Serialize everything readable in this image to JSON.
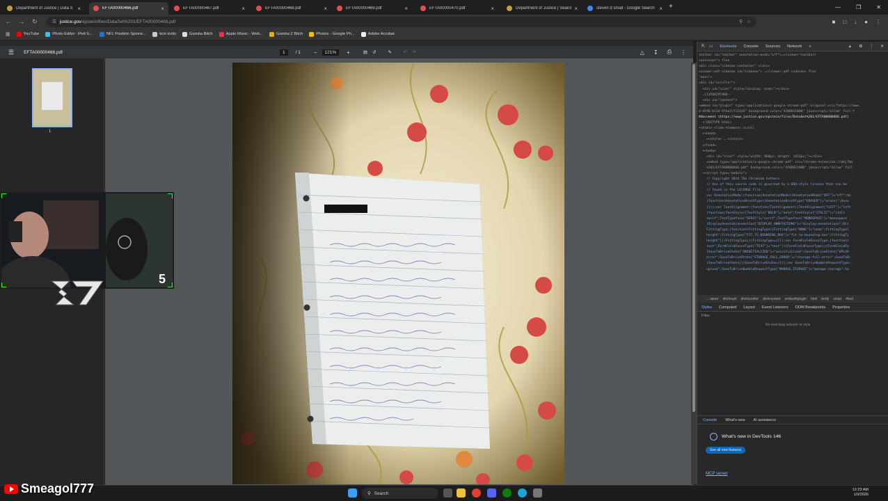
{
  "tabs": [
    {
      "title": "Department of Justice | Data S",
      "color": "#c0a040"
    },
    {
      "title": "EFTA00000466.pdf",
      "color": "#e05050",
      "active": true
    },
    {
      "title": "EFTA00000467.pdf",
      "color": "#e05050"
    },
    {
      "title": "EFTA00000468.pdf",
      "color": "#e05050"
    },
    {
      "title": "EFTA00000469.pdf",
      "color": "#e05050"
    },
    {
      "title": "EFTA00000470.pdf",
      "color": "#e05050"
    },
    {
      "title": "Department of Justice | Search",
      "color": "#c0a040"
    },
    {
      "title": "steven d small - Google Search",
      "color": "#4285f4"
    }
  ],
  "address": {
    "host": "justice.gov",
    "path": "/epstein/files/DataSet%201/EFTA00000466.pdf"
  },
  "bookmarks": [
    {
      "label": "YouTube",
      "color": "#ff0000"
    },
    {
      "label": "Photo Editor : Pixlr E...",
      "color": "#2ec5f0"
    },
    {
      "label": "NFL Position Spinne...",
      "color": "#1a73e8"
    },
    {
      "label": "kick tools",
      "color": "#cccccc"
    },
    {
      "label": "Gamba Bitch",
      "color": "#dddddd"
    },
    {
      "label": "Apple Music - Web...",
      "color": "#fa2d48"
    },
    {
      "label": "Gamba 2 Bitch",
      "color": "#e8b000"
    },
    {
      "label": "Photos - Google Ph...",
      "color": "#fbbc04"
    },
    {
      "label": "Adobe Acrobat",
      "color": "#eeeeee"
    }
  ],
  "pdf": {
    "filename": "EFTA00000466.pdf",
    "page": "1",
    "total": "/ 1",
    "zoom": "121%",
    "thumb_label": "1"
  },
  "devtools": {
    "tabs": [
      "Elements",
      "Console",
      "Sources",
      "Network"
    ],
    "code_lines": [
      "toolbar id=\"toolbar\" annotation-mode=\"off\">…</viewer-toolbar>",
      "container\"> flex",
      "<div class=\"sidenav-container\" class>",
      "<viewer-pdf-sidenav id=\"sidenav\"> …</viewer-pdf-sidenav> flex",
      "",
      "\"main\">",
      "<div id=\"scroller\">",
      "  <div id=\"sizer\" style=\"display: none;\"></div>",
      "  …l1$568291986--",
      "  <div id=\"content\">",
      "<embed id=\"plugin\" type=\"application/x-google-chrome-pdf\" original-url=\"https://www.",
      "d-4596-b11d-5fba7cf152d3\" background-color=\"4280821800\" javascript=\"allow\" full-f",
      "#document (https://www.justice.gov/epstein/files/DataSet%201/EFTA00000466.pdf)",
      "  <!DOCTYPE html>",
      "▾<html> slide-elements scroll",
      "  ▸<head>",
      "    ▸<style> … </style>",
      "  </head>",
      "  ▾<body>",
      "    <div id=\"sizer\" style=\"width: 960px; height: 1413px;\"></div>",
      "    <embed type=\"application/x-google-chrome-pdf\" src=\"chrome-extension://mhjfbm",
      "    %201/EFTA00000466.pdf\" background-color=\"4280821800\" javascript=\"allow\" full",
      "  ▾<script type=\"module\">",
      "    // Copyright 2024 The Chromium Authors",
      "    // Use of this source code is governed by a BSD-style license that can be",
      "    // found in the LICENSE file.",
      "    var AnnotationMode;(function(AnnotationMode){AnnotationMode[\"OFF\"]=\"off\";An",
      "    (function(AnnotationBrushType){AnnotationBrushType[\"ERASER\"]=\"eraser\";Anno",
      "    {}));var TextAlignment;(function(TextAlignment){TextAlignment[\"LEFT\"]=\"left",
      "    (function(TextStyle){TextStyle[\"BOLD\"]=\"bold\";TextStyle[\"ITALIC\"]=\"itali",
      "    serif\";TextTypeface[\"SERIF\"]=\"serif\";TextTypeface[\"MONOSPACE\"]=\"monospace",
      "    (DisplayAnnotationsAction[\"DISPLAY_ANNOTATIONS\"]=\"display-annotations\";Dis",
      "    FittingType;(function(FittingType){FittingType[\"NONE\"]=\"none\";FittingType[",
      "    height\";FittingType[\"FIT_TO_BOUNDING_BOX\"]=\"fit-to-bounding-box\";FittingTy",
      "    height\"})(FittingType||(FittingType={}));var FormFieldFocusType;(function(",
      "    text\";FormFieldFocusType[\"TEXT\"]=\"text\"})(FormFieldFocusType||(FormFieldFo",
      "    {SaveToDriveState[\"UNINITIALIZED\"]=\"uninitialized\";SaveToDriveState[\"UPLOA",
      "    error\";SaveToDriveState[\"STORAGE_FULL_ERROR\"]=\"storage-full-error\";SaveToDr",
      "    (SaveToDriveState||(SaveToDriveState={}));var SaveToDriveBubbleRequestType;",
      "    upload\";SaveToDriveBubbleRequestType[\"MANAGE_STORAGE\"]=\"manage-storage\";Sa"
    ],
    "breadcrumbs": [
      "… lainer",
      "div#main",
      "div#scroller",
      "div#content",
      "embed#plugin",
      "html",
      "body",
      "script",
      "#text"
    ],
    "subtabs": [
      "Styles",
      "Computed",
      "Layout",
      "Event Listeners",
      "DOM Breakpoints",
      "Properties"
    ],
    "filter_placeholder": "Filter",
    "no_match": "No matching selector or style",
    "drawer_tabs": [
      "Console",
      "What's new",
      "AI assistance"
    ],
    "whats_new": "What's new in DevTools 146",
    "see_all": "See all new features",
    "mcp": "MCP server"
  },
  "overlay": {
    "count": "5",
    "handle": "Smeagol777"
  },
  "taskbar": {
    "search": "Search",
    "time": "12:23 AM",
    "date": "1/3/2026"
  }
}
